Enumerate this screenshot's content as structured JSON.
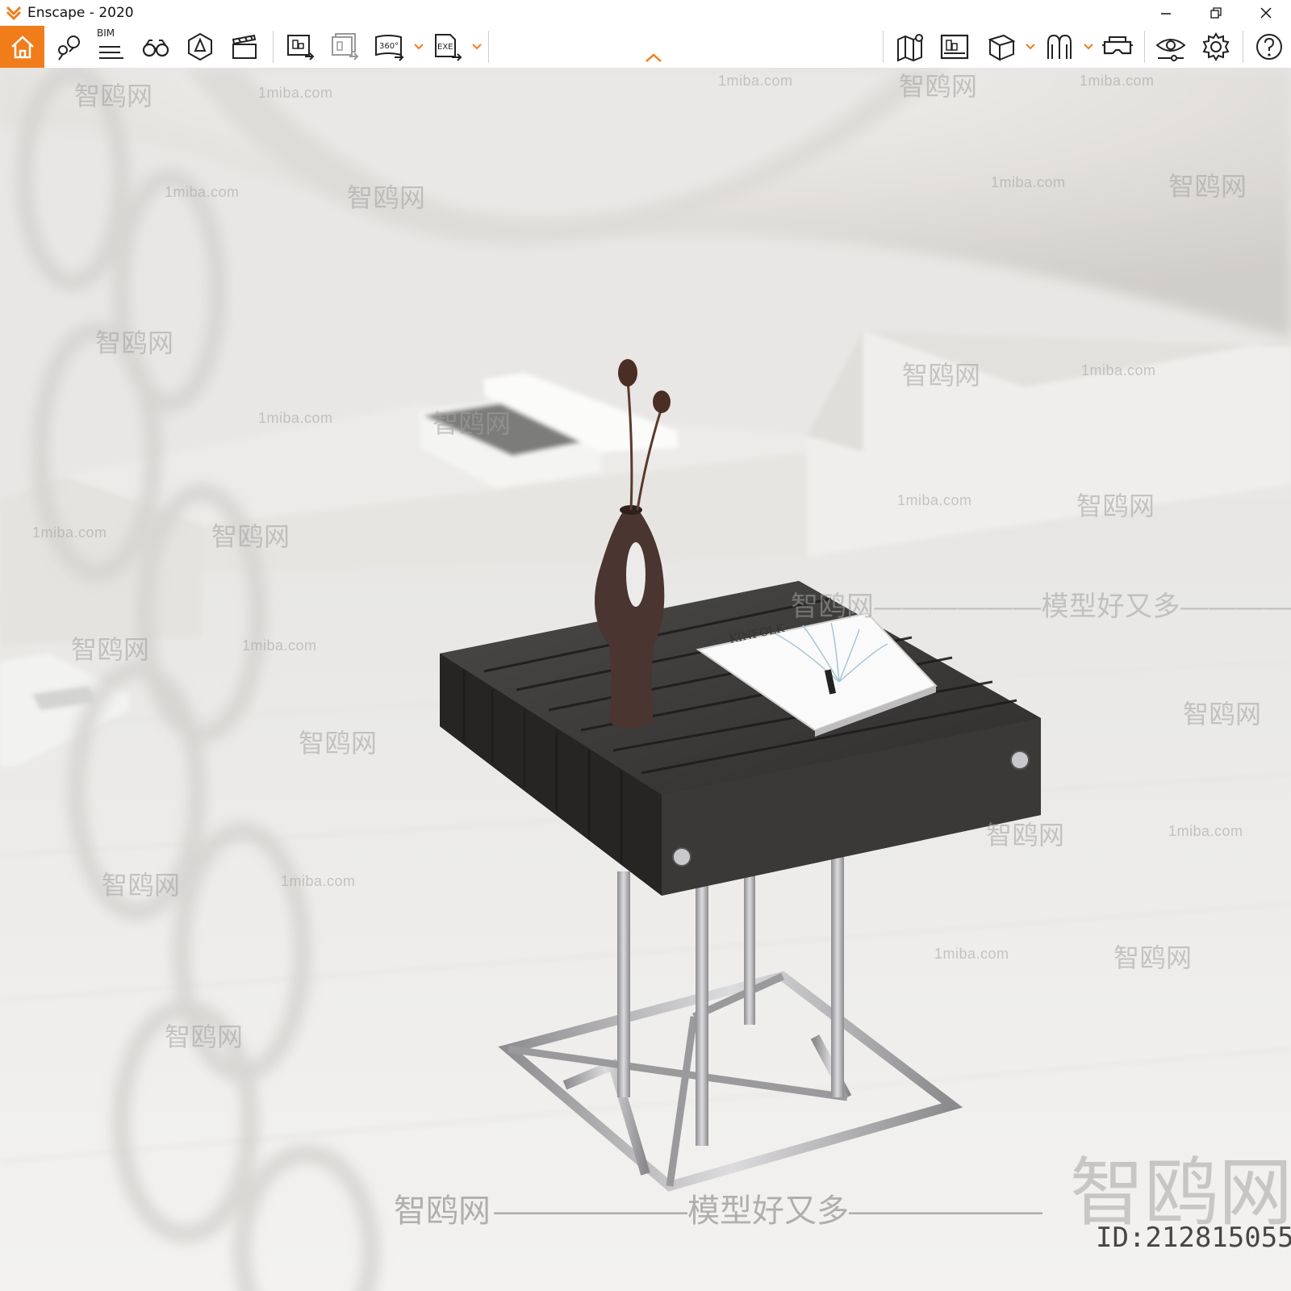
{
  "window": {
    "title": "Enscape - 2020",
    "controls": [
      "minimize",
      "restore",
      "close"
    ]
  },
  "toolbar": {
    "bim_label": "BIM",
    "items_left": [
      "home-icon",
      "location-pins-icon",
      "bim-list-icon",
      "binoculars-icon",
      "hexagon-view-icon",
      "clapper-icon",
      "export-image-icon",
      "batch-export-icon",
      "panorama-360-icon",
      "exe-export-icon"
    ],
    "items_right": [
      "map-icon",
      "asset-library-icon",
      "cube-icon",
      "sun-icon",
      "vr-headset-icon",
      "eye-settings-icon",
      "gear-icon",
      "help-icon"
    ],
    "accent_color": "#f07d1a"
  },
  "watermarks": {
    "site": "1miba.com",
    "brand": "智鸥网",
    "slogan": "智鸥网——————模型好又多——————",
    "slogan_short": "——————模型好又多——————",
    "brand_big": "智鸥网",
    "id": "ID:212815055"
  },
  "scene": {
    "book_title": "KINFOLK",
    "colors": {
      "wall": "#e9e8e6",
      "floor": "#f1f0ee",
      "tabletop": "#3d3c3b",
      "steel": "#b9b9bb",
      "vase": "#4a3530"
    }
  }
}
